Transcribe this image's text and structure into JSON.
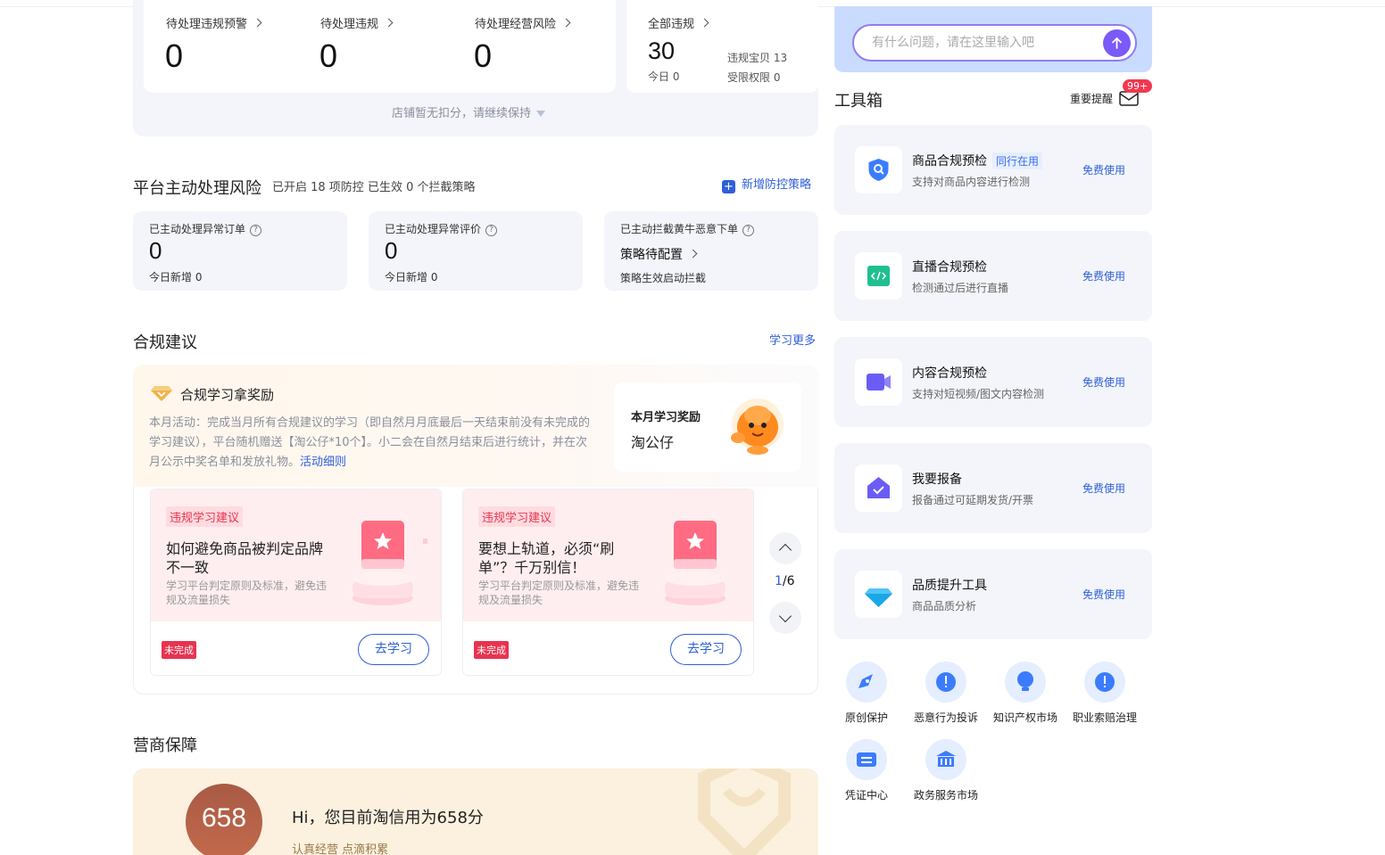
{
  "violations": {
    "items": [
      {
        "label": "待处理违规预警",
        "value": "0"
      },
      {
        "label": "待处理违规",
        "value": "0"
      },
      {
        "label": "待处理经营风险",
        "value": "0"
      }
    ],
    "all": {
      "label": "全部违规",
      "value": "30",
      "today": "今日 0",
      "treasure": "违规宝贝 13",
      "limited": "受限权限 0"
    },
    "deduction_note": "店铺暂无扣分，请继续保持"
  },
  "platform_risk": {
    "title": "平台主动处理风险",
    "summary": "已开启 18 项防控 已生效 0 个拦截策略",
    "add_label": "新增防控策略",
    "cards": [
      {
        "label": "已主动处理异常订单",
        "value": "0",
        "sub": "今日新增 0"
      },
      {
        "label": "已主动处理异常评价",
        "value": "0",
        "sub": "今日新增 0"
      },
      {
        "label": "已主动拦截黄牛恶意下单",
        "value": "策略待配置",
        "sub": "策略生效启动拦截"
      }
    ]
  },
  "compliance": {
    "title": "合规建议",
    "more": "学习更多",
    "reward_title": "合规学习拿奖励",
    "reward_desc": "本月活动：完成当月所有合规建议的学习（即自然月月底最后一天结束前没有未完成的学习建议），平台随机赠送【淘公仔*10个】。小二会在自然月结束后进行统计，并在次月公示中奖名单和发放礼物。",
    "reward_link": "活动细则",
    "monthly_label": "本月学习奖励",
    "monthly_value": "淘公仔",
    "cards": [
      {
        "tag": "违规学习建议",
        "title": "如何避免商品被判定品牌不一致",
        "desc": "学习平台判定原则及标准，避免违规及流量损失",
        "status": "未完成",
        "button": "去学习"
      },
      {
        "tag": "违规学习建议",
        "title": "要想上轨道，必须“刷单”？千万别信！",
        "desc": "学习平台判定原则及标准，避免违规及流量损失",
        "status": "未完成",
        "button": "去学习"
      }
    ],
    "pager_current": "1",
    "pager_total": "/6"
  },
  "guarantee": {
    "title": "营商保障",
    "score": "658",
    "greeting": "Hi，您目前淘信用为658分",
    "motto": "认真经营 点滴积累"
  },
  "assistant": {
    "placeholder": "有什么问题，请在这里输入吧"
  },
  "toolbox": {
    "title": "工具箱",
    "reminder": "重要提醒",
    "badge": "99+",
    "tools": [
      {
        "name": "商品合规预检",
        "peer": "同行在用",
        "desc": "支持对商品内容进行检测",
        "action": "免费使用",
        "icon": "shield-search-icon",
        "color": "#3b7cff"
      },
      {
        "name": "直播合规预检",
        "peer": "",
        "desc": "检测通过后进行直播",
        "action": "免费使用",
        "icon": "code-icon",
        "color": "#1fbf8f"
      },
      {
        "name": "内容合规预检",
        "peer": "",
        "desc": "支持对短视频/图文内容检测",
        "action": "免费使用",
        "icon": "video-icon",
        "color": "#6b5cf5"
      },
      {
        "name": "我要报备",
        "peer": "",
        "desc": "报备通过可延期发货/开票",
        "action": "免费使用",
        "icon": "check-envelope-icon",
        "color": "#6b5cf5"
      },
      {
        "name": "品质提升工具",
        "peer": "",
        "desc": "商品品质分析",
        "action": "免费使用",
        "icon": "diamond-icon",
        "color": "#1aa7e8"
      }
    ],
    "quick": [
      {
        "label": "原创保护",
        "icon": "pen-icon"
      },
      {
        "label": "恶意行为投诉",
        "icon": "alert-icon"
      },
      {
        "label": "知识产权市场",
        "icon": "bulb-icon"
      },
      {
        "label": "职业索赔治理",
        "icon": "alert-icon"
      },
      {
        "label": "凭证中心",
        "icon": "ticket-icon"
      },
      {
        "label": "政务服务市场",
        "icon": "bank-icon"
      }
    ]
  }
}
